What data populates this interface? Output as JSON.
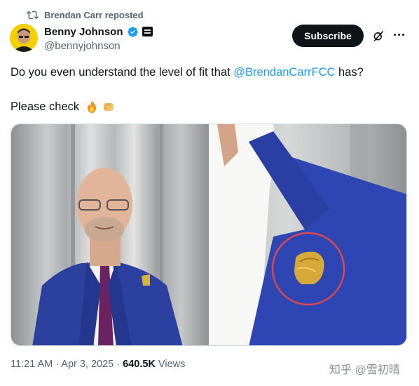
{
  "repost": {
    "label": "Brendan Carr reposted"
  },
  "author": {
    "name": "Benny Johnson",
    "handle": "@bennyjohnson"
  },
  "actions": {
    "subscribe_label": "Subscribe"
  },
  "tweet": {
    "text_prefix": "Do you even understand the level of fit that ",
    "mention": "@BrendanCarrFCC",
    "text_suffix": " has?",
    "line2": "Please check"
  },
  "meta": {
    "time": "11:21 AM · Apr 3, 2025 · ",
    "views_count": "640.5K",
    "views_label": " Views"
  },
  "watermark": {
    "text": "知乎 @雪初晴"
  },
  "colors": {
    "accent": "#1d9bf0",
    "verified": "#1d9bf0",
    "subscribe_bg": "#0f1419",
    "secondary_text": "#536471"
  },
  "icons": [
    "repost-icon",
    "verified-badge-icon",
    "affiliate-badge-icon",
    "grok-icon",
    "more-icon",
    "fire-emoji-icon",
    "fist-emoji-icon"
  ]
}
